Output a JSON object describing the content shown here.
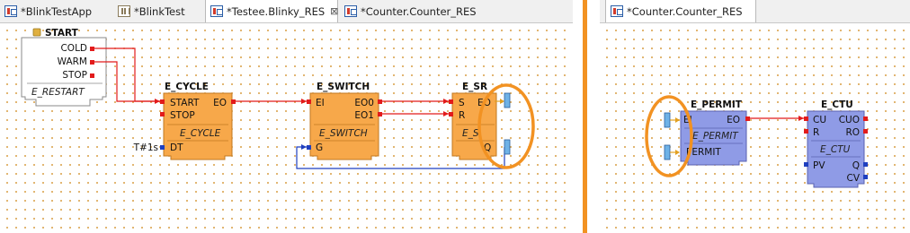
{
  "left_tabs": [
    {
      "label": "*BlinkTestApp",
      "icon": "application-icon",
      "active": false
    },
    {
      "label": "*BlinkTest",
      "icon": "system-grid-icon",
      "active": false
    },
    {
      "label": "*Testee.Blinky_RES",
      "icon": "resource-icon",
      "active": true,
      "close": "⊠"
    },
    {
      "label": "*Counter.Counter_RES",
      "icon": "resource-icon",
      "active": false
    }
  ],
  "right_tabs": [
    {
      "label": "*Counter.Counter_RES",
      "icon": "resource-icon",
      "active": true
    }
  ],
  "colors": {
    "highlight": "#f29222",
    "event_line": "#e21b1b",
    "data_line": "#1f3fbf",
    "fb_orange": "#f7a84a",
    "fb_blue": "#8f9be6"
  },
  "left_diagram": {
    "start_block": {
      "title": "START",
      "type": "E_RESTART",
      "events": [
        "COLD",
        "WARM",
        "STOP"
      ]
    },
    "e_cycle": {
      "title": "E_CYCLE",
      "type": "E_CYCLE",
      "event_inputs": [
        "START",
        "STOP"
      ],
      "event_outputs": [
        "EO"
      ],
      "data_inputs": [
        "DT"
      ],
      "dt_value": "T#1s"
    },
    "e_switch": {
      "title": "E_SWITCH",
      "type": "E_SWITCH",
      "event_inputs": [
        "EI"
      ],
      "event_outputs": [
        "EO0",
        "EO1"
      ],
      "data_inputs": [
        "G"
      ]
    },
    "e_sr": {
      "title": "E_SR",
      "type_visible": "E_S",
      "event_inputs": [
        "S",
        "R"
      ],
      "event_outputs_visible": [
        "EO"
      ],
      "data_output_visible": "Q"
    }
  },
  "right_diagram": {
    "e_permit": {
      "title": "E_PERMIT",
      "type": "E_PERMIT",
      "event_inputs_visible": [
        "EI"
      ],
      "event_outputs": [
        "EO"
      ],
      "data_inputs_visible": [
        "PERMIT"
      ]
    },
    "e_ctu": {
      "title": "E_CTU",
      "type": "E_CTU",
      "event_inputs": [
        "CU",
        "R"
      ],
      "event_outputs": [
        "CUO",
        "RO"
      ],
      "data_inputs": [
        "PV"
      ],
      "data_outputs": [
        "Q",
        "CV"
      ]
    }
  }
}
